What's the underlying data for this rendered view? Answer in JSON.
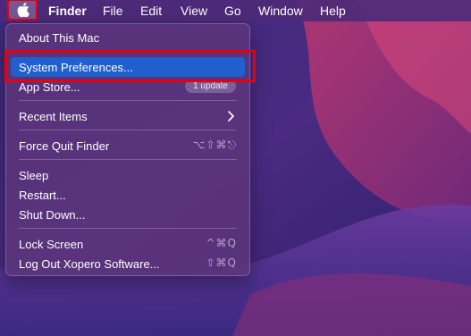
{
  "menubar": {
    "apple_icon": "apple-logo-icon",
    "items": [
      "Finder",
      "File",
      "Edit",
      "View",
      "Go",
      "Window",
      "Help"
    ]
  },
  "apple_menu": {
    "about": "About This Mac",
    "system_preferences": "System Preferences...",
    "app_store": "App Store...",
    "app_store_badge": "1 update",
    "recent_items": "Recent Items",
    "force_quit": "Force Quit Finder",
    "force_quit_shortcut": "⌥⇧⌘⎋",
    "sleep": "Sleep",
    "restart": "Restart...",
    "shut_down": "Shut Down...",
    "lock_screen": "Lock Screen",
    "lock_screen_shortcut": "^⌘Q",
    "log_out": "Log Out Xopero Software...",
    "log_out_shortcut": "⇧⌘Q"
  },
  "colors": {
    "highlight": "#1f5fce",
    "annotation": "#e3000f",
    "menubar": "#4e2a78"
  }
}
